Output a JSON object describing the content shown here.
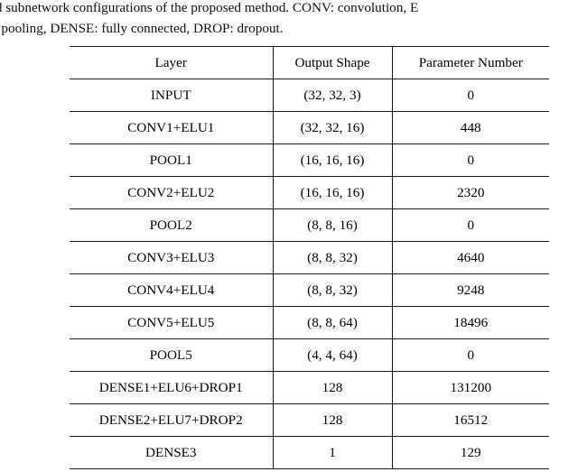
{
  "caption": {
    "line1": "etailed subnetwork configurations of the proposed method. CONV: convolution, E",
    "line2": "x pooling, DENSE: fully connected, DROP: dropout."
  },
  "table": {
    "columns": [
      "Layer",
      "Output Shape",
      "Parameter Number"
    ],
    "rows": [
      {
        "layer": "INPUT",
        "shape": "(32, 32, 3)",
        "params": "0"
      },
      {
        "layer": "CONV1+ELU1",
        "shape": "(32, 32, 16)",
        "params": "448"
      },
      {
        "layer": "POOL1",
        "shape": "(16, 16, 16)",
        "params": "0"
      },
      {
        "layer": "CONV2+ELU2",
        "shape": "(16, 16, 16)",
        "params": "2320"
      },
      {
        "layer": "POOL2",
        "shape": "(8, 8, 16)",
        "params": "0"
      },
      {
        "layer": "CONV3+ELU3",
        "shape": "(8, 8, 32)",
        "params": "4640"
      },
      {
        "layer": "CONV4+ELU4",
        "shape": "(8, 8, 32)",
        "params": "9248"
      },
      {
        "layer": "CONV5+ELU5",
        "shape": "(8, 8, 64)",
        "params": "18496"
      },
      {
        "layer": "POOL5",
        "shape": "(4, 4, 64)",
        "params": "0"
      },
      {
        "layer": "DENSE1+ELU6+DROP1",
        "shape": "128",
        "params": "131200"
      },
      {
        "layer": "DENSE2+ELU7+DROP2",
        "shape": "128",
        "params": "16512"
      },
      {
        "layer": "DENSE3",
        "shape": "1",
        "params": "129"
      }
    ]
  }
}
